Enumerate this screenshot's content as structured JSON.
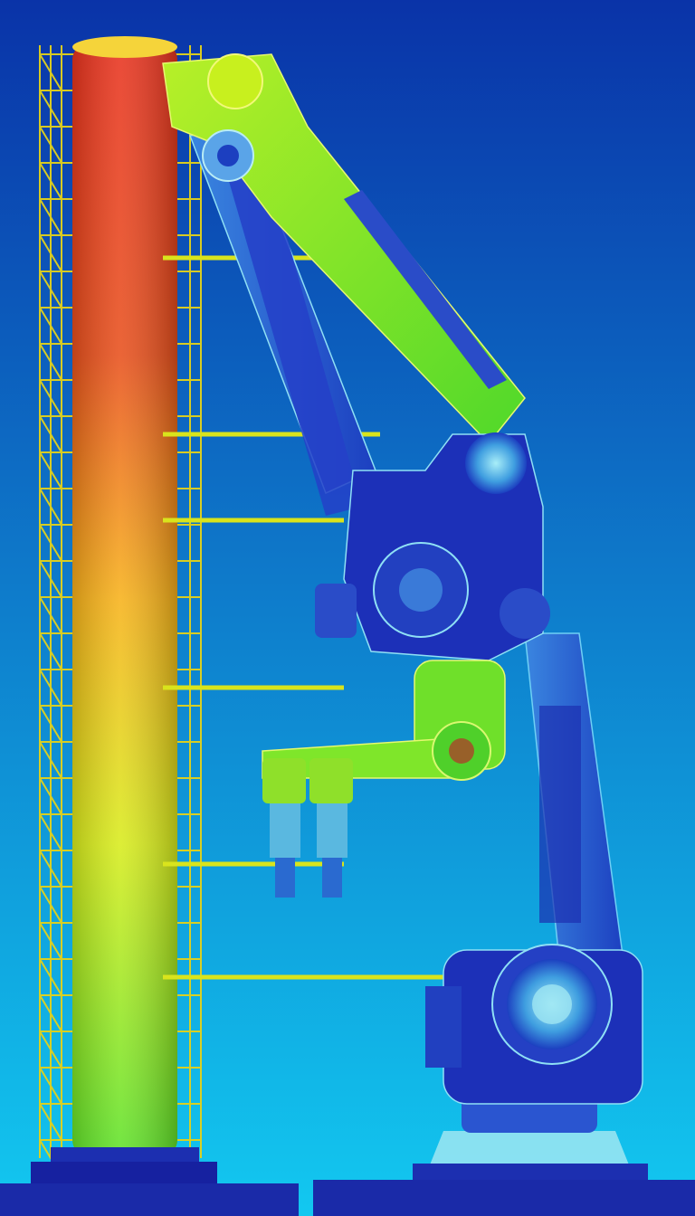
{
  "scene": {
    "subject": "robot-arm-thermal-render",
    "colors": {
      "bg_top": "#0a33a8",
      "bg_bottom": "#12c8f0",
      "hot": "#e8321e",
      "warm": "#f7b21a",
      "mid": "#c8f01e",
      "green": "#6fe02a",
      "cool": "#2f7ad8",
      "cold": "#1c2fb0",
      "deep": "#1621a0",
      "pale": "#9fe6f2",
      "scaffold": "#e3d21a"
    },
    "labels": []
  }
}
